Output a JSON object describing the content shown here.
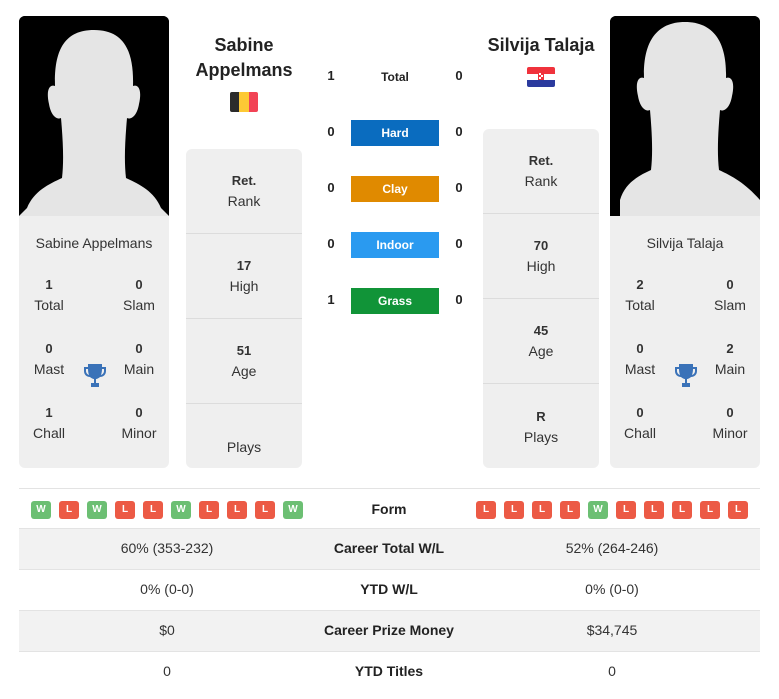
{
  "players": {
    "left": {
      "name": "Sabine Appelmans",
      "header_line1": "Sabine",
      "header_line2": "Appelmans",
      "country_flag": "belgium-flag",
      "titles": {
        "total": {
          "value": "1",
          "label": "Total"
        },
        "slam": {
          "value": "0",
          "label": "Slam"
        },
        "mast": {
          "value": "0",
          "label": "Mast"
        },
        "main": {
          "value": "0",
          "label": "Main"
        },
        "chall": {
          "value": "1",
          "label": "Chall"
        },
        "minor": {
          "value": "0",
          "label": "Minor"
        }
      },
      "info": {
        "rank": {
          "value": "Ret.",
          "label": "Rank"
        },
        "high": {
          "value": "17",
          "label": "High"
        },
        "age": {
          "value": "51",
          "label": "Age"
        },
        "plays": {
          "value": "",
          "label": "Plays"
        }
      },
      "form": [
        "W",
        "L",
        "W",
        "L",
        "L",
        "W",
        "L",
        "L",
        "L",
        "W"
      ]
    },
    "right": {
      "name": "Silvija Talaja",
      "header": "Silvija Talaja",
      "country_flag": "croatia-flag",
      "titles": {
        "total": {
          "value": "2",
          "label": "Total"
        },
        "slam": {
          "value": "0",
          "label": "Slam"
        },
        "mast": {
          "value": "0",
          "label": "Mast"
        },
        "main": {
          "value": "2",
          "label": "Main"
        },
        "chall": {
          "value": "0",
          "label": "Chall"
        },
        "minor": {
          "value": "0",
          "label": "Minor"
        }
      },
      "info": {
        "rank": {
          "value": "Ret.",
          "label": "Rank"
        },
        "high": {
          "value": "70",
          "label": "High"
        },
        "age": {
          "value": "45",
          "label": "Age"
        },
        "plays": {
          "value": "R",
          "label": "Plays"
        }
      },
      "form": [
        "L",
        "L",
        "L",
        "L",
        "W",
        "L",
        "L",
        "L",
        "L",
        "L"
      ]
    }
  },
  "h2h": [
    {
      "label": "Total",
      "left": "1",
      "right": "0",
      "color": null
    },
    {
      "label": "Hard",
      "left": "0",
      "right": "0",
      "color": "#0a6cbf"
    },
    {
      "label": "Clay",
      "left": "0",
      "right": "0",
      "color": "#e08a00"
    },
    {
      "label": "Indoor",
      "left": "0",
      "right": "0",
      "color": "#2a9af0"
    },
    {
      "label": "Grass",
      "left": "1",
      "right": "0",
      "color": "#119438"
    }
  ],
  "form_label": "Form",
  "stats": [
    {
      "label": "Career Total W/L",
      "left": "60% (353-232)",
      "right": "52% (264-246)"
    },
    {
      "label": "YTD W/L",
      "left": "0% (0-0)",
      "right": "0% (0-0)"
    },
    {
      "label": "Career Prize Money",
      "left": "$0",
      "right": "$34,745"
    },
    {
      "label": "YTD Titles",
      "left": "0",
      "right": "0"
    }
  ],
  "colors": {
    "win": "#6cbf73",
    "loss": "#ec5a45",
    "trophy": "#3a72b8"
  }
}
